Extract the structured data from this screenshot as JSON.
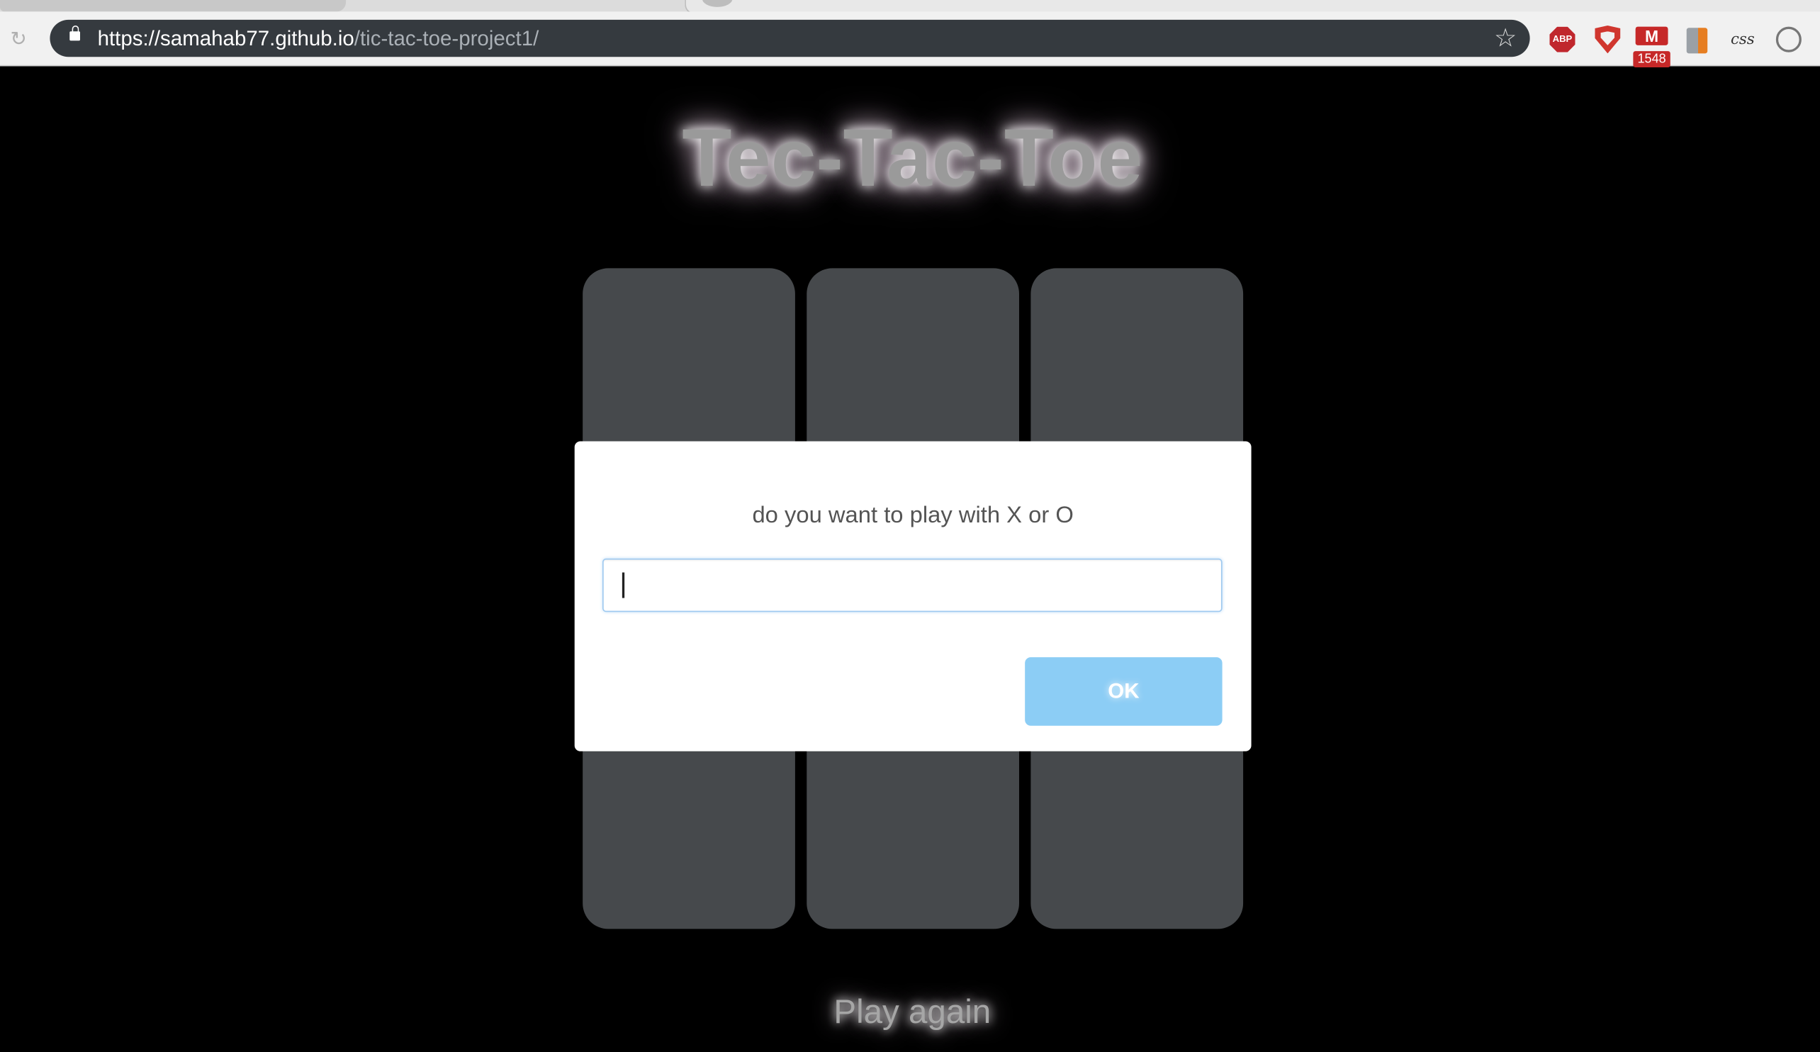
{
  "browser": {
    "url_host": "https://samahab77.github.io",
    "url_path": "/tic-tac-toe-project1/",
    "extensions": {
      "adblock_label": "ABP",
      "gmail_count": "1548",
      "css_label": "css"
    },
    "icons": [
      "reload-icon",
      "lock-icon",
      "bookmark-star-icon",
      "adblock-icon",
      "shield-icon",
      "gmail-icon",
      "office-icon",
      "css-extension-icon",
      "profile-icon"
    ]
  },
  "page": {
    "title": "Tec-Tac-Toe",
    "board_cells": [
      "",
      "",
      "",
      "",
      "",
      "",
      "",
      "",
      ""
    ],
    "play_again_label": "Play again"
  },
  "dialog": {
    "prompt": "do you want to play with X or O",
    "input_value": "",
    "ok_label": "OK"
  },
  "colors": {
    "background": "#000000",
    "cell": "#46494c",
    "ok_button": "#8ccdf5",
    "title_text": "#9a9a9a"
  }
}
